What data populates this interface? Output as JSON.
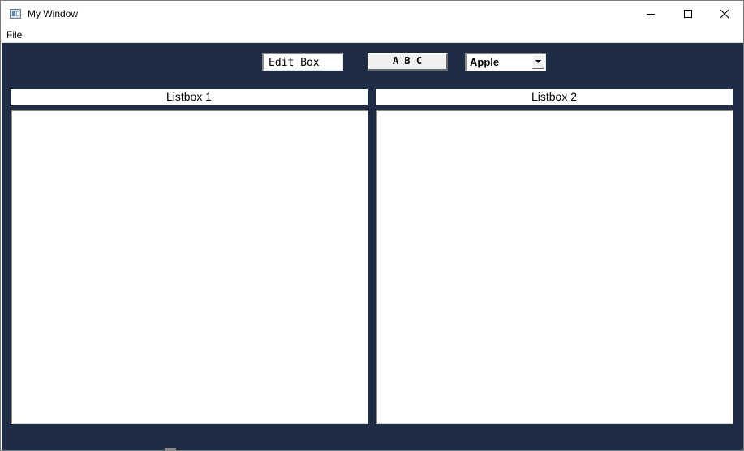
{
  "window": {
    "title": "My Window",
    "caption_buttons": [
      "minimize-icon",
      "maximize-icon",
      "close-icon"
    ]
  },
  "menu": {
    "items": [
      {
        "label": "File"
      }
    ]
  },
  "toolbar": {
    "edit_box_value": "Edit Box",
    "button_label": "A B C",
    "combo_selected": "Apple"
  },
  "lists": [
    {
      "title": "Listbox 1",
      "items": []
    },
    {
      "title": "Listbox 2",
      "items": []
    }
  ],
  "colors": {
    "client_background": "#1e2c46",
    "window_background": "#ffffff"
  }
}
